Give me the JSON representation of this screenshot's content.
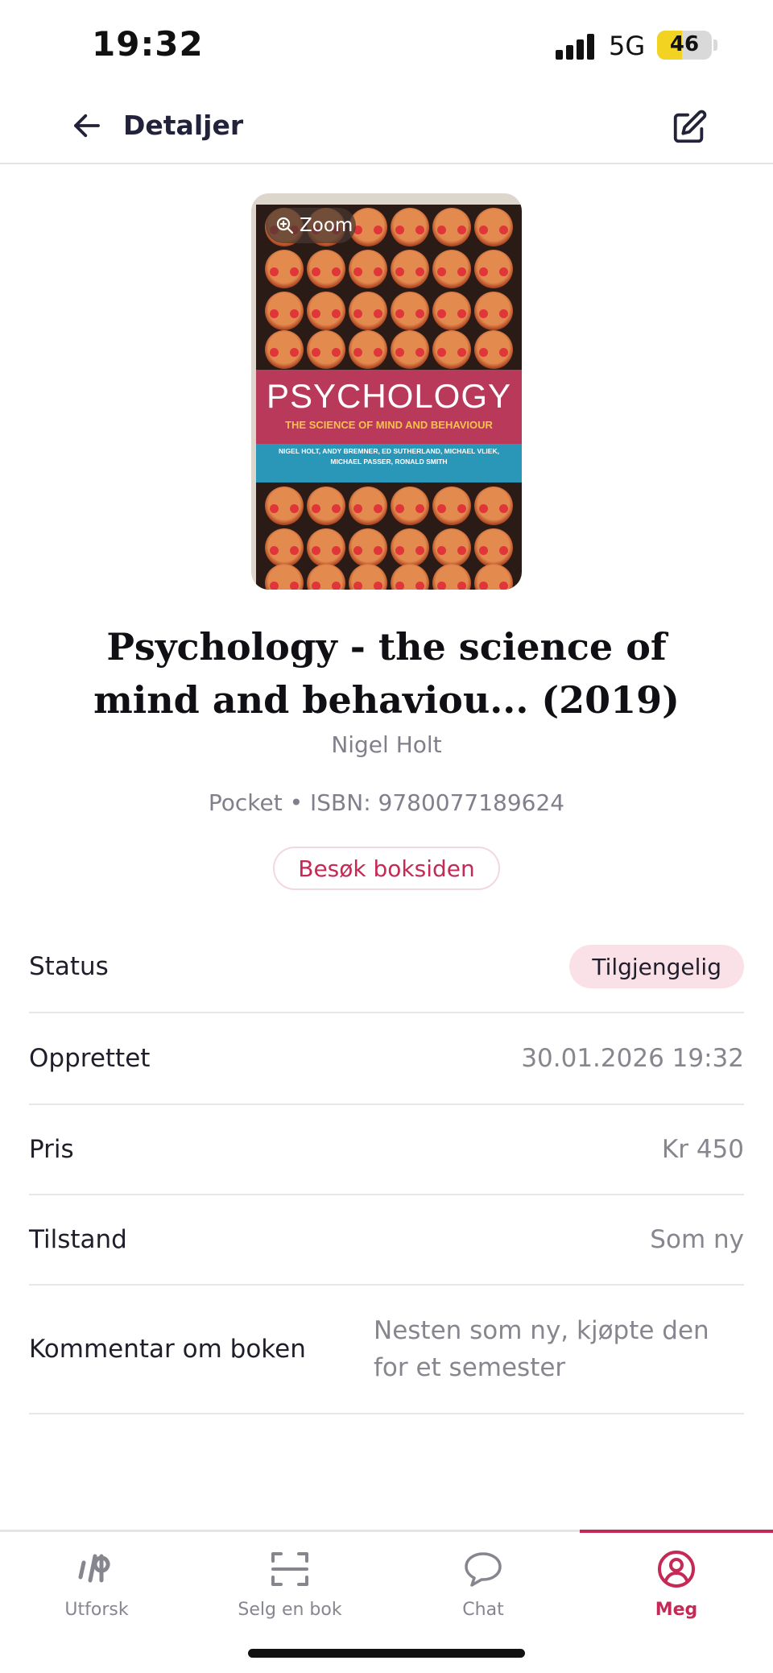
{
  "status_bar": {
    "time": "19:32",
    "network": "5G",
    "battery": "46",
    "battery_level": 0.46
  },
  "header": {
    "title": "Detaljer",
    "back_icon": "arrow-left-icon",
    "edit_icon": "edit-square-icon"
  },
  "cover": {
    "zoom_label": "Zoom",
    "zoom_icon": "zoom-in-icon",
    "title_text": "PSYCHOLOGY",
    "subtitle_text": "THE SCIENCE OF MIND AND BEHAVIOUR",
    "authors_text": "NIGEL HOLT, ANDY BREMNER, ED SUTHERLAND, MICHAEL VLIEK, MICHAEL PASSER, RONALD SMITH"
  },
  "book": {
    "title": "Psychology - the science of mind and behaviou... (2019)",
    "author": "Nigel Holt",
    "meta": "Pocket • ISBN: 9780077189624",
    "visit_button": "Besøk boksiden"
  },
  "details": {
    "status_label": "Status",
    "status_value": "Tilgjengelig",
    "created_label": "Opprettet",
    "created_value": "30.01.2026 19:32",
    "price_label": "Pris",
    "price_value": "Kr 450",
    "condition_label": "Tilstand",
    "condition_value": "Som ny",
    "comment_label": "Kommentar om boken",
    "comment_value": "Nesten som ny, kjøpte den for et semester"
  },
  "nav": {
    "items": [
      {
        "label": "Utforsk",
        "icon": "logo-ib-icon"
      },
      {
        "label": "Selg en bok",
        "icon": "scan-frame-icon"
      },
      {
        "label": "Chat",
        "icon": "chat-bubble-icon"
      },
      {
        "label": "Meg",
        "icon": "user-circle-icon",
        "active": true
      }
    ]
  },
  "colors": {
    "accent": "#c42a55",
    "pill_bg": "#fae1e8",
    "muted_text": "#86868f",
    "divider": "#e6e7ea"
  }
}
